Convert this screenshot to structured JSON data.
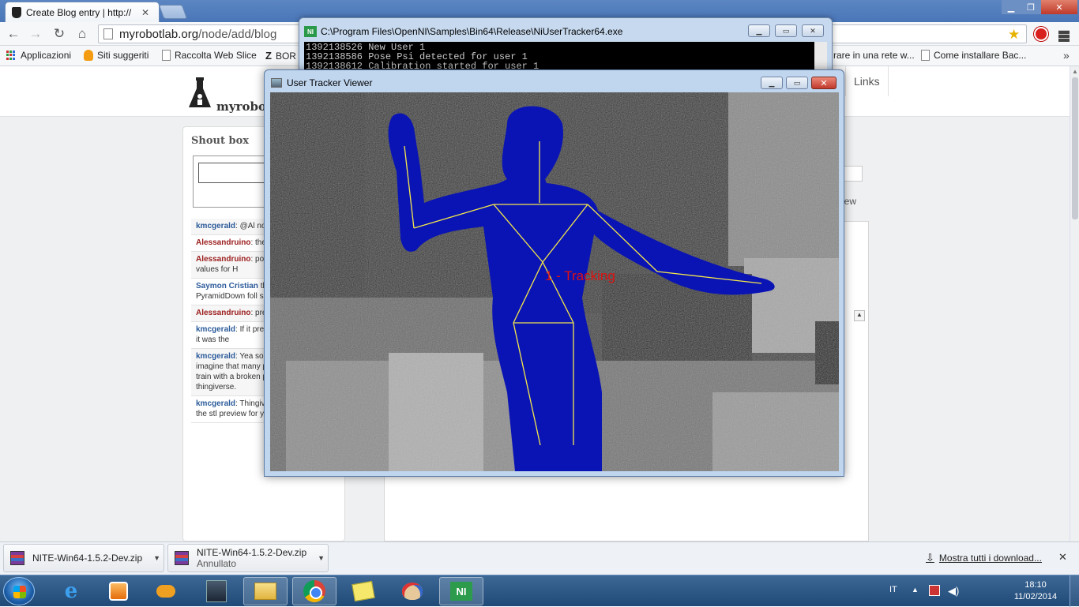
{
  "browser": {
    "tab_title": "Create Blog entry | http://",
    "url_host": "myrobotlab.org",
    "url_path": "/node/add/blog",
    "bookmarks": [
      "Applicazioni",
      "Siti suggeriti",
      "Raccolta Web Slice",
      "BOR",
      "rare in una rete w...",
      "Come installare Bac..."
    ]
  },
  "site": {
    "name": "myrobot",
    "nav_links": "Links",
    "preview_label": "iew"
  },
  "shoutbox": {
    "title": "Shout box",
    "shouts": [
      {
        "author": "kmcgerald",
        "color": "blue",
        "text": ": @Al now."
      },
      {
        "author": "Alessandruino",
        "color": "red",
        "text": ": the ball in white"
      },
      {
        "author": "Alessandruino",
        "color": "red",
        "text": ": post..you have to best values for H"
      },
      {
        "author": "Saymon Cristian",
        "color": "blue",
        "text": " the filter InRange PyramidDown foll some object?"
      },
      {
        "author": "Alessandruino",
        "color": "red",
        "text": ": preview:("
      },
      {
        "author": "kmcgerald",
        "color": "blue",
        "text": ": If it preview, I would thought it was the"
      },
      {
        "author": "kmcgerald",
        "color": "blue",
        "text": ": Yea so many people d I can't imagine that many people have that old train with a broken part and are on thingiverse."
      },
      {
        "author": "kmcgerald",
        "color": "blue",
        "text": ": Thingiverse should generate the stl preview for you"
      }
    ]
  },
  "console": {
    "title": "C:\\Program Files\\OpenNI\\Samples\\Bin64\\Release\\NiUserTracker64.exe",
    "lines": [
      "1392138526 New User 1",
      "1392138586 Pose Psi detected for user 1",
      "1392138612 Calibration started for user 1"
    ]
  },
  "tracker": {
    "title": "User Tracker Viewer",
    "status_label": "1 - Tracking"
  },
  "downloads": {
    "items": [
      {
        "name": "NITE-Win64-1.5.2-Dev.zip",
        "status": ""
      },
      {
        "name": "NITE-Win64-1.5.2-Dev.zip",
        "status": "Annullato"
      }
    ],
    "show_all": "Mostra tutti i download..."
  },
  "taskbar": {
    "language": "IT",
    "time": "18:10",
    "date": "11/02/2014"
  },
  "colors": {
    "user_fill": "#0a14b4",
    "skeleton": "#f5e84a",
    "tracking_label": "#e01010"
  }
}
